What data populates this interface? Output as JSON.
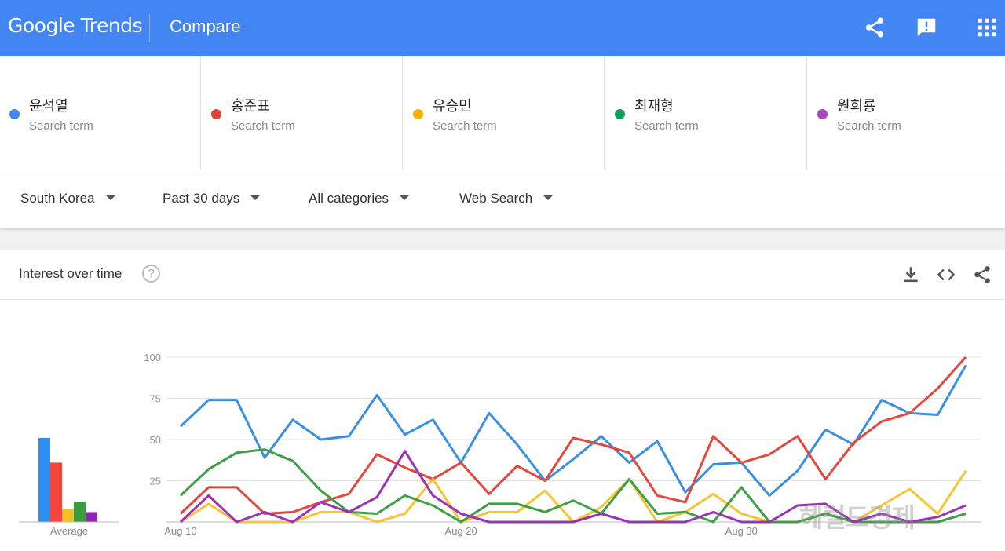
{
  "header": {
    "logo_google": "Google",
    "logo_trends": "Trends",
    "title": "Compare",
    "icons": [
      "share-icon",
      "feedback-icon",
      "apps-icon"
    ]
  },
  "terms": [
    {
      "name": "윤석열",
      "sub": "Search term",
      "color": "#4285f4"
    },
    {
      "name": "홍준표",
      "sub": "Search term",
      "color": "#db4437"
    },
    {
      "name": "유승민",
      "sub": "Search term",
      "color": "#f4b400"
    },
    {
      "name": "최재형",
      "sub": "Search term",
      "color": "#0f9d58"
    },
    {
      "name": "원희룡",
      "sub": "Search term",
      "color": "#ab47bc"
    }
  ],
  "filters": {
    "region": "South Korea",
    "time": "Past 30 days",
    "category": "All categories",
    "search_type": "Web Search"
  },
  "card": {
    "title": "Interest over time",
    "help": "?",
    "icons": [
      "download-icon",
      "embed-icon",
      "share-icon"
    ]
  },
  "watermark": "헤럴드경제",
  "chart_data": {
    "type": "line",
    "title": "Interest over time",
    "x": [
      "Aug 10",
      "Aug 11",
      "Aug 12",
      "Aug 13",
      "Aug 14",
      "Aug 15",
      "Aug 16",
      "Aug 17",
      "Aug 18",
      "Aug 19",
      "Aug 20",
      "Aug 21",
      "Aug 22",
      "Aug 23",
      "Aug 24",
      "Aug 25",
      "Aug 26",
      "Aug 27",
      "Aug 28",
      "Aug 29",
      "Aug 30",
      "Aug 31",
      "Sep 1",
      "Sep 2",
      "Sep 3",
      "Sep 4",
      "Sep 5",
      "Sep 6",
      "Sep 7"
    ],
    "x_tick_labels": [
      "Aug 10",
      "Aug 20",
      "Aug 30"
    ],
    "y_ticks": [
      25,
      50,
      75,
      100
    ],
    "ylim": [
      0,
      100
    ],
    "grid": true,
    "series": [
      {
        "name": "윤석열",
        "color": "#3b8fe0",
        "values": [
          58,
          74,
          74,
          39,
          62,
          50,
          52,
          77,
          53,
          62,
          36,
          66,
          47,
          25,
          38,
          52,
          36,
          49,
          18,
          35,
          36,
          16,
          31,
          56,
          47,
          74,
          66,
          65,
          95
        ]
      },
      {
        "name": "홍준표",
        "color": "#e2483d",
        "values": [
          5,
          21,
          21,
          5,
          6,
          12,
          17,
          41,
          33,
          26,
          36,
          17,
          34,
          25,
          51,
          47,
          42,
          16,
          12,
          52,
          36,
          41,
          52,
          26,
          48,
          61,
          66,
          81,
          100
        ]
      },
      {
        "name": "유승민",
        "color": "#f7c533",
        "values": [
          0,
          11,
          0,
          0,
          0,
          6,
          6,
          0,
          5,
          26,
          0,
          6,
          6,
          19,
          0,
          9,
          26,
          0,
          6,
          17,
          5,
          0,
          0,
          5,
          0,
          10,
          20,
          5,
          31
        ]
      },
      {
        "name": "최재형",
        "color": "#3e9f44",
        "values": [
          16,
          32,
          42,
          44,
          37,
          19,
          6,
          5,
          16,
          10,
          0,
          11,
          11,
          6,
          13,
          5,
          26,
          5,
          6,
          0,
          21,
          0,
          0,
          5,
          0,
          0,
          0,
          0,
          5
        ]
      },
      {
        "name": "원희룡",
        "color": "#9a34b5",
        "values": [
          0,
          16,
          0,
          6,
          0,
          12,
          6,
          15,
          43,
          16,
          5,
          0,
          0,
          0,
          0,
          5,
          0,
          0,
          0,
          6,
          0,
          0,
          10,
          11,
          0,
          5,
          0,
          3,
          10
        ]
      }
    ],
    "average": {
      "label": "Average",
      "values": [
        51,
        36,
        8,
        12,
        6
      ]
    }
  }
}
